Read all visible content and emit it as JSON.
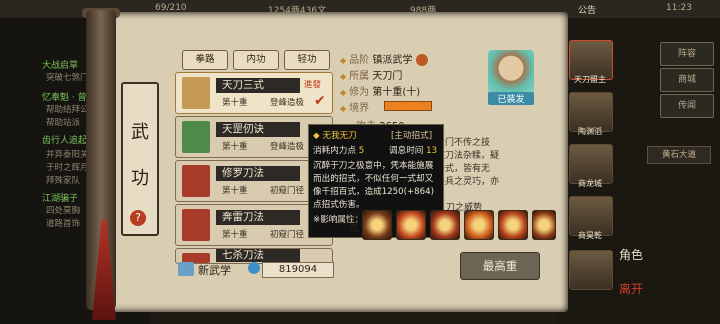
{
  "status": {
    "progress": "69/210",
    "money": "1254两436文",
    "gold": "988两",
    "notice": "公告",
    "clock": "11:23"
  },
  "quests": [
    {
      "title": "大战启草",
      "desc": "突破七煞门"
    },
    {
      "title": "忆奉魁 · 曾",
      "desc": "帮助结拜公"
    },
    {
      "title": "",
      "desc": "帮助站派"
    },
    {
      "title": "齿行人追起",
      "desc": "并弃泰阳关"
    },
    {
      "title": "",
      "desc": "于时之辉月"
    },
    {
      "title": "",
      "desc": "拜殊家队"
    },
    {
      "title": "江湖骗子",
      "desc": "四处莫胸"
    },
    {
      "title": "",
      "desc": "道路首饰"
    }
  ],
  "side_buttons": [
    "阵容",
    "商城",
    "传闻"
  ],
  "side_chip": "黄石大道",
  "heroes": [
    {
      "name": "天刀盟主"
    },
    {
      "name": "陶渊滔"
    },
    {
      "name": "商龙城"
    },
    {
      "name": "商昊乾"
    },
    {
      "name": ""
    }
  ],
  "side_labels": {
    "role": "角色",
    "leave": "离开"
  },
  "title_chars": [
    "武",
    "功"
  ],
  "help": "?",
  "tabs": [
    "拳路",
    "内功",
    "轻功"
  ],
  "skills": [
    {
      "name": "天刀三式",
      "level": "第十重",
      "rank": "登峰造极",
      "tag": "進發",
      "selected": true,
      "color": "#c49a54"
    },
    {
      "name": "天罡仞诀",
      "level": "第十重",
      "rank": "登峰造极",
      "tag": "",
      "selected": false,
      "color": "#4f8a4a"
    },
    {
      "name": "修罗刀法",
      "level": "第十重",
      "rank": "初窥门径",
      "tag": "",
      "selected": false,
      "color": "#a83a2a"
    },
    {
      "name": "奔雷刀法",
      "level": "第十重",
      "rank": "初窥门径",
      "tag": "",
      "selected": false,
      "color": "#a83a2a"
    },
    {
      "name": "七杀刀法",
      "level": "",
      "rank": "",
      "tag": "",
      "selected": false,
      "color": "#a83a2a"
    }
  ],
  "footer": {
    "new_skill": "新武学",
    "points": "819094"
  },
  "info": {
    "grade_label": "品阶",
    "grade": "镇派武学",
    "sect_label": "所属",
    "sect": "天刀门",
    "cult_label": "修为",
    "cult": "第十重(十)",
    "realm_label": "境界",
    "attack_label": "攻击",
    "attack": "2650",
    "realm_level": 0.8,
    "desc": "是天刀门不传之技\n我诸家刀法杂糅，疑\n论哪一式，皆有无\n快刀轻兵之灵巧，亦",
    "equipped": "已装发"
  },
  "tooltip": {
    "name": "无我无刀",
    "type": "[主动招式]",
    "cost_label": "消耗内力点",
    "cost": "5",
    "cd_label": "调息时间",
    "cd": "13",
    "body": [
      "沉醉于刀之极意中，凭本能施展",
      "而出的招式，不似任何一式却又",
      "像千招百式，造成1250(+864)",
      "点招式伤害。"
    ],
    "affect": "※影响属性：「臂力」"
  },
  "moves_label": "招式",
  "moves_extra": "刀之威势",
  "moves": [
    "#7a3d1a",
    "#c44a22",
    "#a3361b",
    "#d15d1e",
    "#b7421b",
    "#8d3a16"
  ],
  "max_button": "最高重"
}
